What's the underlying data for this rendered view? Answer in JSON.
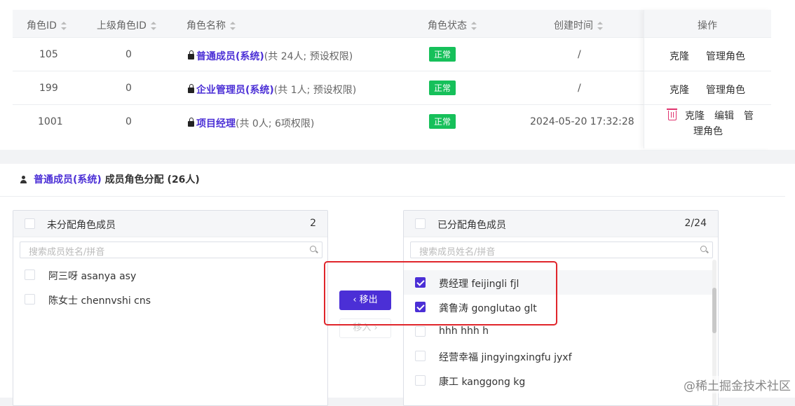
{
  "table": {
    "headers": {
      "role_id": "角色ID",
      "parent_id": "上级角色ID",
      "role_name": "角色名称",
      "role_status": "角色状态",
      "created_at": "创建时间",
      "actions": "操作"
    },
    "rows": [
      {
        "id": "105",
        "parent": "0",
        "name": "普通成员(系统)",
        "meta": "(共 24人; 预设权限)",
        "status": "正常",
        "created": "/",
        "clone": "克隆",
        "manage": "管理角色"
      },
      {
        "id": "199",
        "parent": "0",
        "name": "企业管理员(系统)",
        "meta": "(共 1人; 预设权限)",
        "status": "正常",
        "created": "/",
        "clone": "克隆",
        "manage": "管理角色"
      },
      {
        "id": "1001",
        "parent": "0",
        "name": "项目经理",
        "meta": "(共 0人; 6项权限)",
        "status": "正常",
        "created": "2024-05-20 17:32:28",
        "clone": "克隆",
        "edit": "编辑",
        "manage_line1": "管",
        "manage_line2": "理角色"
      }
    ]
  },
  "assign": {
    "title_link": "普通成员(系统)",
    "title_rest": " 成员角色分配 (26人)",
    "left_panel": {
      "title": "未分配角色成员",
      "count": "2",
      "search_placeholder": "搜索成员姓名/拼音",
      "items": [
        "阿三呀 asanya asy",
        "陈女士 chennvshi cns"
      ]
    },
    "right_panel": {
      "title": "已分配角色成员",
      "count": "2/24",
      "search_placeholder": "搜索成员姓名/拼音",
      "items": [
        {
          "label": "费经理 feijingli fjl",
          "checked": true
        },
        {
          "label": "龚鲁涛 gonglutao glt",
          "checked": true
        },
        {
          "label": "hhh hhh h",
          "checked": false
        },
        {
          "label": "经营幸福 jingyingxingfu jyxf",
          "checked": false
        },
        {
          "label": "康工 kanggong kg",
          "checked": false
        }
      ]
    },
    "move_out_label": "移出",
    "move_in_label": "移入"
  },
  "watermark": "@稀土掘金技术社区"
}
